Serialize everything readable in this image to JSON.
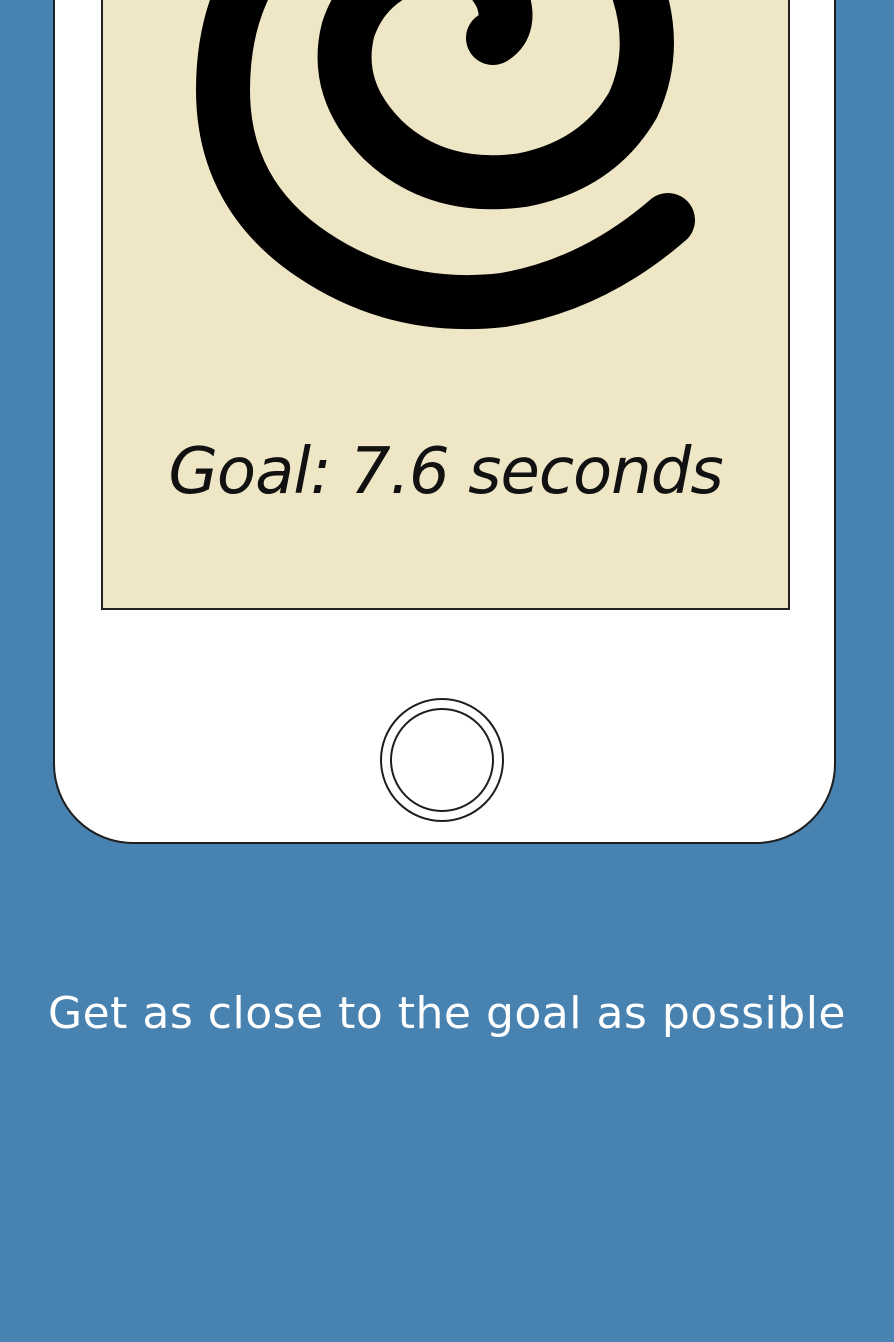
{
  "screen": {
    "goal_text": "Goal: 7.6 seconds",
    "spiral_icon": "spiral-icon",
    "background_color": "#efe6c6"
  },
  "device": {
    "home_button_icon": "home-button-icon",
    "frame_color": "#ffffff"
  },
  "caption": {
    "text": "Get as close to the goal as possible"
  },
  "page": {
    "background_color": "#4882b1"
  }
}
